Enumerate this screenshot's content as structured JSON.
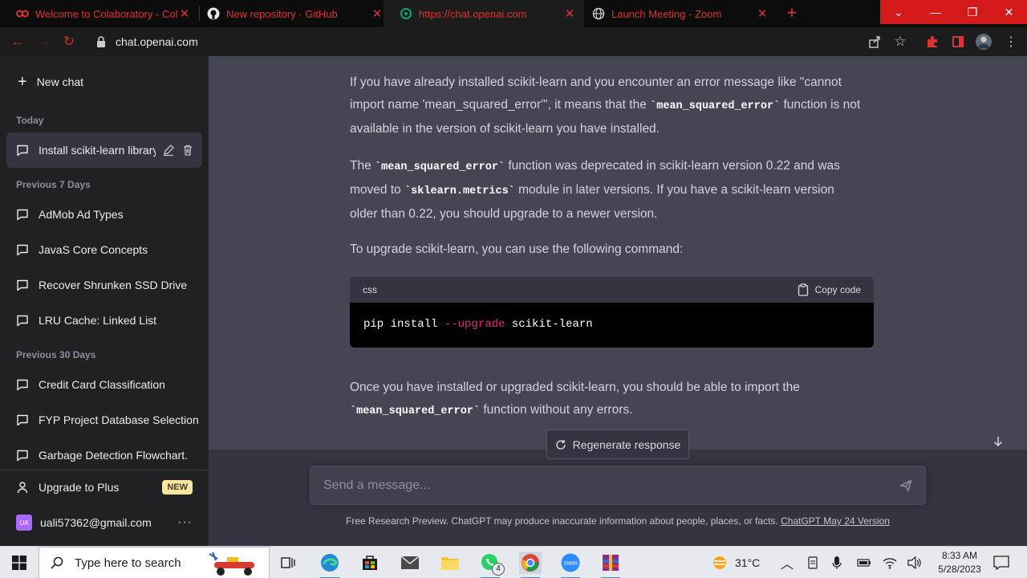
{
  "browser": {
    "tabs": [
      {
        "title": "Welcome to Colaboratory - Colab",
        "icon": "colab-icon"
      },
      {
        "title": "New repository · GitHub",
        "icon": "github-icon"
      },
      {
        "title": "https://chat.openai.com",
        "icon": "openai-icon"
      },
      {
        "title": "Launch Meeting - Zoom",
        "icon": "globe-icon"
      }
    ],
    "new_tab": "+",
    "url": "chat.openai.com"
  },
  "sidebar": {
    "new_chat": "New chat",
    "groups": {
      "today": "Today",
      "prev7": "Previous 7 Days",
      "prev30": "Previous 30 Days"
    },
    "items": [
      {
        "label": "Install scikit-learn library"
      },
      {
        "label": "AdMob Ad Types"
      },
      {
        "label": "JavaS Core Concepts"
      },
      {
        "label": "Recover Shrunken SSD Drive"
      },
      {
        "label": "LRU Cache: Linked List"
      },
      {
        "label": "Credit Card Classification"
      },
      {
        "label": "FYP Project Database Selection"
      },
      {
        "label": "Garbage Detection Flowchart."
      }
    ],
    "upgrade": "Upgrade to Plus",
    "upgrade_badge": "NEW",
    "user_initials": "UA",
    "user_email": "uali57362@gmail.com",
    "more": "···"
  },
  "chat": {
    "p1": {
      "a": "If you have already installed scikit-learn and you encounter an error message like \"cannot import name 'mean_squared_error'\", it means that the ",
      "code": "`mean_squared_error`",
      "b": " function is not available in the version of scikit-learn you have installed."
    },
    "p2": {
      "a": "The ",
      "code1": "`mean_squared_error`",
      "b": " function was deprecated in scikit-learn version 0.22 and was moved to ",
      "code2": "`sklearn.metrics`",
      "c": " module in later versions. If you have a scikit-learn version older than 0.22, you should upgrade to a newer version."
    },
    "p3": "To upgrade scikit-learn, you can use the following command:",
    "code_block": {
      "language": "css",
      "copy_label": "Copy code",
      "cmd": "pip install ",
      "flag": "--upgrade",
      "pkg": " scikit-learn"
    },
    "p4": {
      "a": "Once you have installed or upgraded scikit-learn, you should be able to import the ",
      "code": "`mean_squared_error`",
      "b": " function without any errors."
    },
    "regenerate": "Regenerate response",
    "input_placeholder": "Send a message...",
    "disclaimer": "Free Research Preview. ChatGPT may produce inaccurate information about people, places, or facts. ",
    "disclaimer_link": "ChatGPT May 24 Version"
  },
  "taskbar": {
    "search_placeholder": "Type here to search",
    "weather": "31°C",
    "whatsapp_badge": "4",
    "time": "8:33 AM",
    "date": "5/28/2023"
  },
  "colors": {
    "sidebar_bg": "#202123",
    "chat_bg": "#444654",
    "input_bg": "#40414f",
    "accent_red": "#e0322f"
  }
}
